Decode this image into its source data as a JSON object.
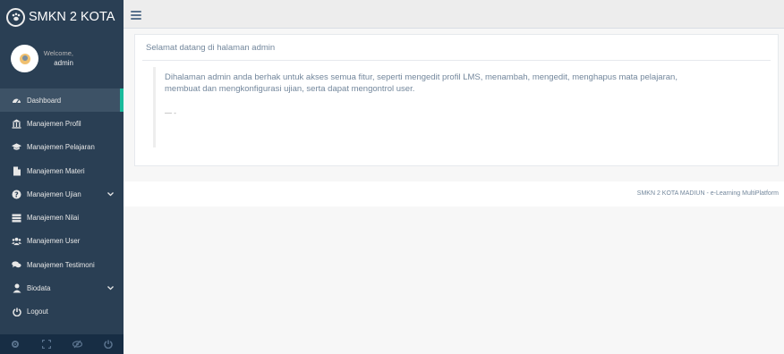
{
  "brand": {
    "title": "SMKN 2 KOTA",
    "logo_icon": "paw-icon"
  },
  "profile": {
    "welcome": "Welcome,",
    "username": "admin"
  },
  "menu": [
    {
      "label": "Dashboard",
      "icon": "tachometer-icon",
      "active": true
    },
    {
      "label": "Manajemen Profil",
      "icon": "institution-icon"
    },
    {
      "label": "Manajemen Pelajaran",
      "icon": "graduation-cap-icon"
    },
    {
      "label": "Manajemen Materi",
      "icon": "file-icon"
    },
    {
      "label": "Manajemen Ujian",
      "icon": "question-circle-icon",
      "has_submenu": true
    },
    {
      "label": "Manajemen Nilai",
      "icon": "table-icon"
    },
    {
      "label": "Manajemen User",
      "icon": "users-icon"
    },
    {
      "label": "Manajemen Testimoni",
      "icon": "comments-icon"
    },
    {
      "label": "Biodata",
      "icon": "user-icon",
      "has_submenu": true
    },
    {
      "label": "Logout",
      "icon": "power-off-icon"
    }
  ],
  "sidebar_footer_icons": [
    "cog-icon",
    "fullscreen-icon",
    "eye-slash-icon",
    "power-off-icon"
  ],
  "panel": {
    "title": "Selamat datang di halaman admin",
    "text": "Dihalaman admin anda berhak untuk akses semua fitur, seperti mengedit profil LMS, menambah, mengedit, menghapus mata pelajaran, membuat dan mengkonfigurasi ujian, serta dapat mengontrol user.",
    "footer": "— -"
  },
  "footer": {
    "text": "SMKN 2 KOTA MADIUN - e-Learning MultiPlatform"
  },
  "colors": {
    "sidebar": "#2a3f54",
    "active_border": "#1abb9c",
    "text_muted": "#73879c"
  }
}
